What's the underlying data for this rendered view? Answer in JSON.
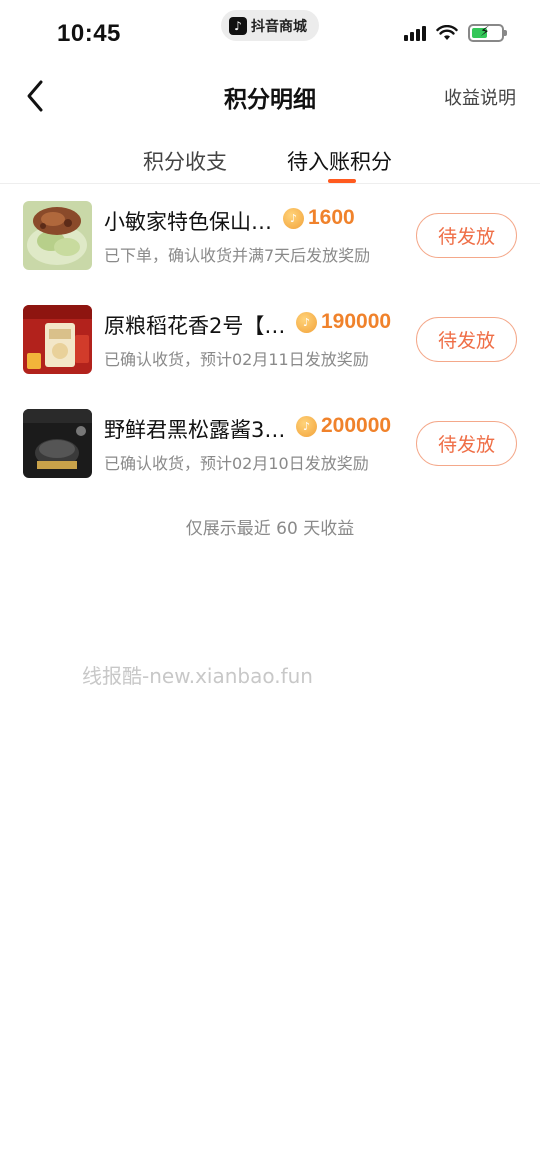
{
  "status_bar": {
    "time": "10:45",
    "app_pill_label": "抖音商城"
  },
  "nav": {
    "title": "积分明细",
    "right_link": "收益说明"
  },
  "tabs": [
    {
      "label": "积分收支",
      "active": false
    },
    {
      "label": "待入账积分",
      "active": true
    }
  ],
  "items": [
    {
      "title": "小敏家特色保山…",
      "points": "1600",
      "subtitle": "已下单，确认收货并满7天后发放奖励",
      "button": "待发放"
    },
    {
      "title": "原粮稻花香2号【…",
      "points": "190000",
      "subtitle": "已确认收货，预计02月11日发放奖励",
      "button": "待发放"
    },
    {
      "title": "野鲜君黑松露酱3…",
      "points": "200000",
      "subtitle": "已确认收货，预计02月10日发放奖励",
      "button": "待发放"
    }
  ],
  "footer_note": "仅展示最近 60 天收益",
  "watermark": "线报酷-new.xianbao.fun",
  "colors": {
    "accent": "#ff5a1f",
    "points": "#f0822b",
    "button_text": "#ef6e46",
    "button_border": "#f4a88a"
  }
}
